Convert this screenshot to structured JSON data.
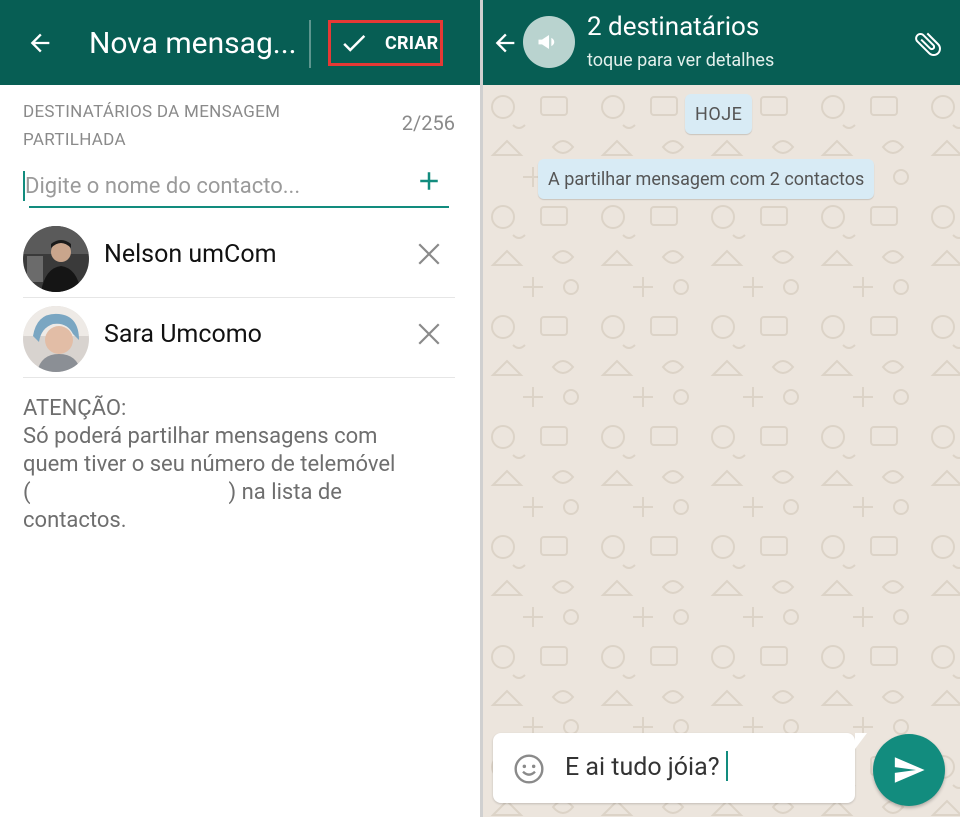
{
  "left_panel": {
    "title": "Nova mensag...",
    "create_label": "CRIAR",
    "recipients_label": "DESTINATÁRIOS DA MENSAGEM PARTILHADA",
    "count": "2/256",
    "search": {
      "placeholder": "Digite o nome do contacto..."
    },
    "contacts": [
      {
        "name": "Nelson umCom"
      },
      {
        "name": "Sara Umcomo"
      }
    ],
    "warning": {
      "heading": "ATENÇÃO:",
      "line1": "Só poderá partilhar mensagens com",
      "line2": "quem tiver o seu número de telemóvel",
      "line3_left": "(",
      "line3_right": ") na lista de",
      "line4": "contactos."
    }
  },
  "right_panel": {
    "title": "2 destinatários",
    "subtitle": "toque para ver detalhes",
    "day_chip": "HOJE",
    "system_message": "A partilhar mensagem com 2 contactos",
    "composer": {
      "text": "E ai tudo jóia?"
    }
  },
  "colors": {
    "primary_dark": "#075e54",
    "accent": "#128c7e",
    "chat_bg": "#ece5dd",
    "chip_bg": "#d8ebf5",
    "highlight_box": "#e53935"
  },
  "icons": [
    "back-arrow-icon",
    "check-icon",
    "plus-icon",
    "close-icon",
    "megaphone-icon",
    "paperclip-icon",
    "emoji-icon",
    "send-icon"
  ]
}
